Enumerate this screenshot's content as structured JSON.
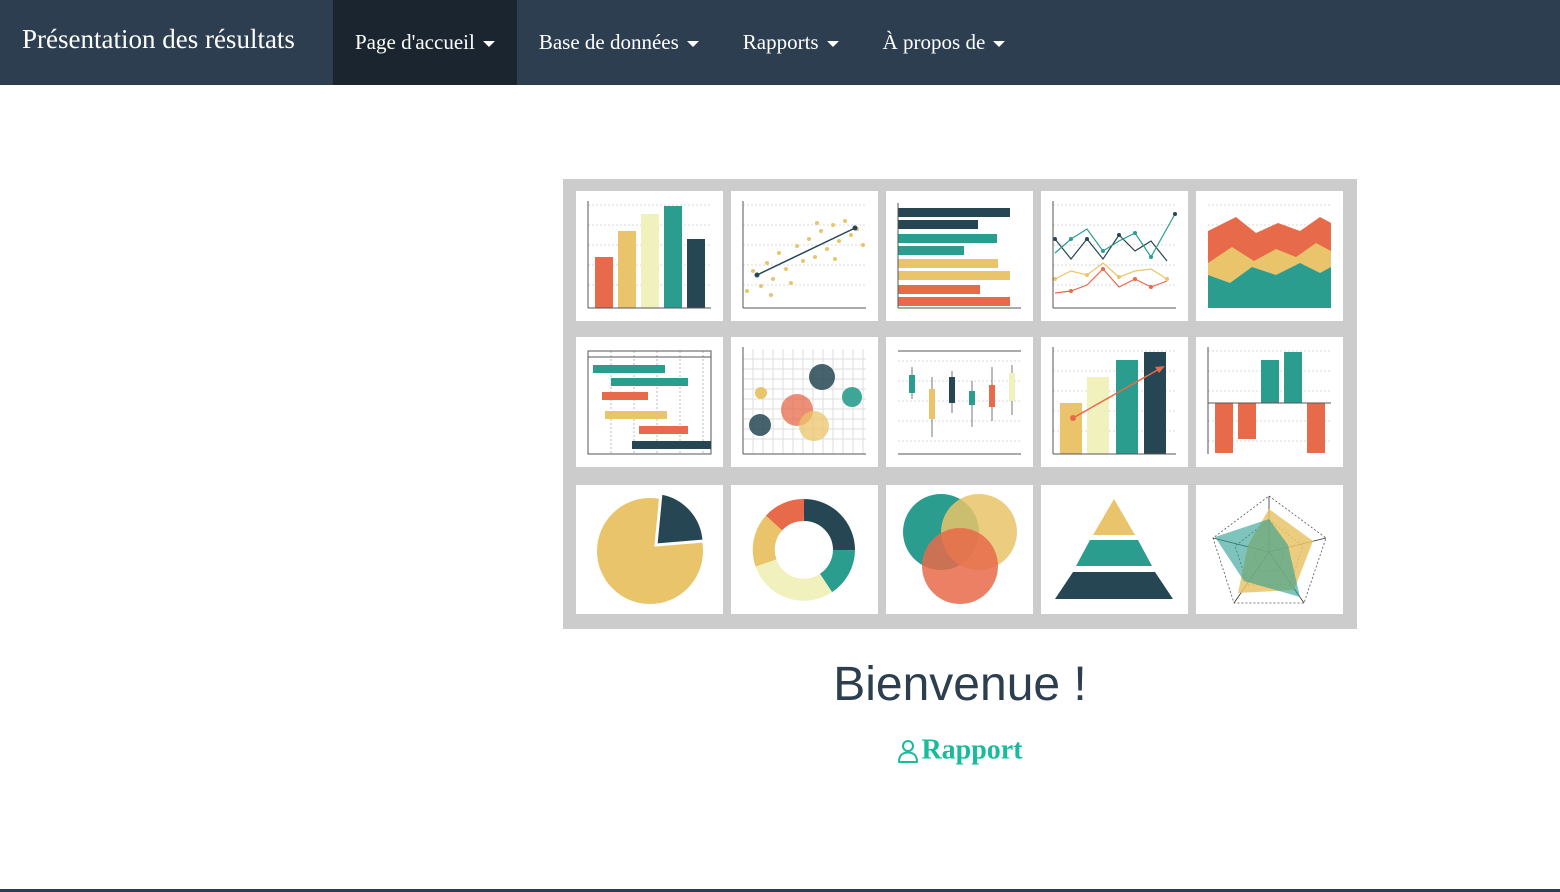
{
  "navbar": {
    "brand": "Présentation des résultats",
    "items": [
      {
        "label": "Page d'accueil",
        "active": true
      },
      {
        "label": "Base de données"
      },
      {
        "label": "Rapports"
      },
      {
        "label": "À propos de"
      }
    ]
  },
  "main": {
    "title": "Bienvenue !",
    "report_link": "Rapport",
    "report_icon": "user-icon"
  },
  "colors": {
    "navbar": "#2c3e50",
    "navbar_active": "#1a252f",
    "accent": "#18bc9c",
    "chart_red": "#e76a4a",
    "chart_yellow": "#e9c46a",
    "chart_cream": "#f1f1bd",
    "chart_teal": "#2a9d8f",
    "chart_navy": "#264653"
  },
  "illustration": {
    "icons": [
      "bar-chart-icon",
      "scatter-chart-icon",
      "horizontal-bar-chart-icon",
      "line-chart-icon",
      "area-chart-icon",
      "gantt-chart-icon",
      "bubble-chart-icon",
      "candlestick-chart-icon",
      "trend-bar-chart-icon",
      "waterfall-chart-icon",
      "pie-chart-icon",
      "donut-chart-icon",
      "venn-diagram-icon",
      "pyramid-chart-icon",
      "radar-chart-icon"
    ]
  }
}
